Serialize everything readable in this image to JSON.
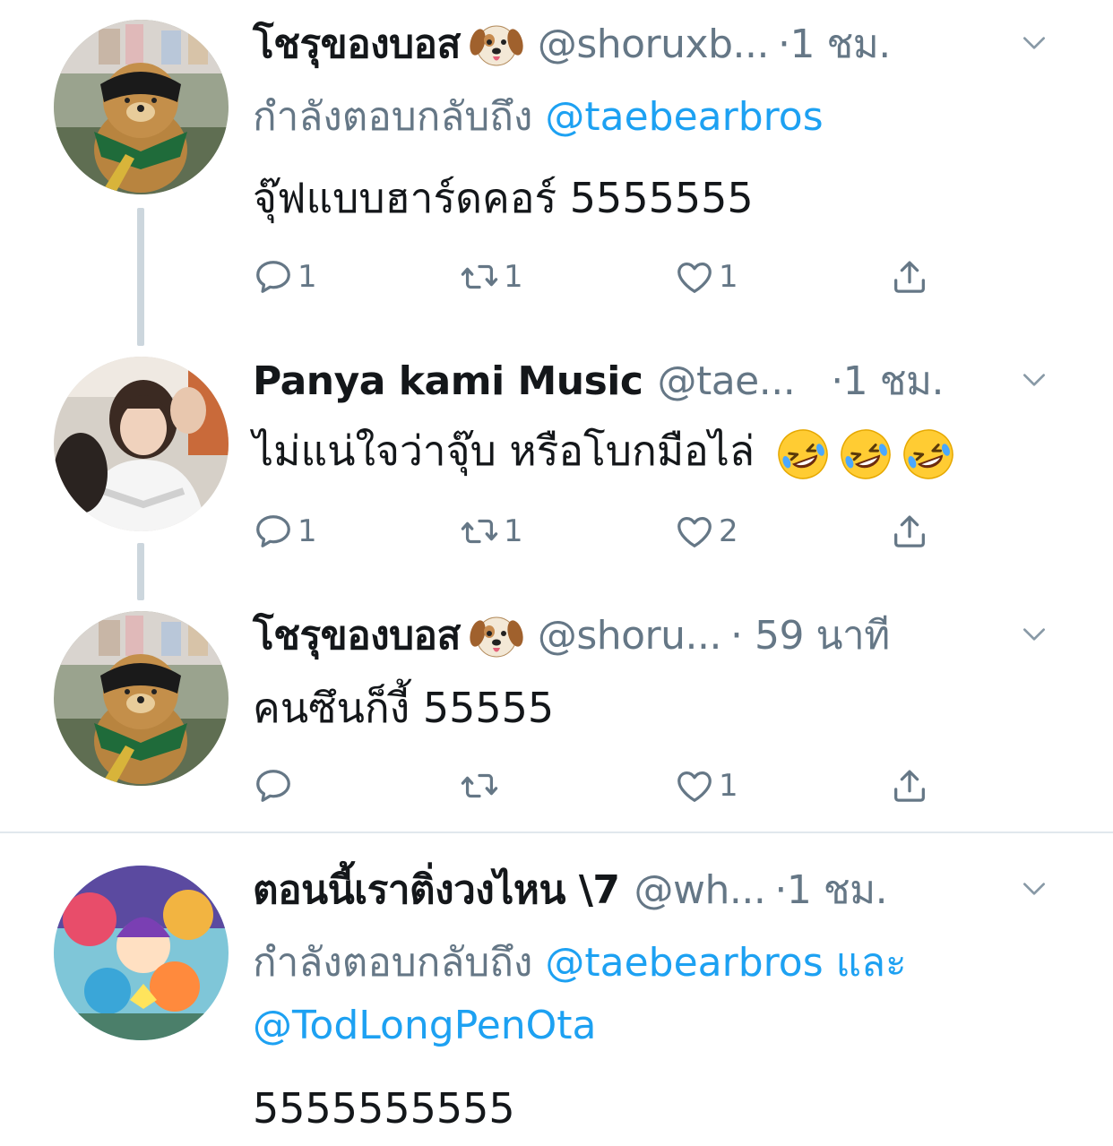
{
  "tweets": [
    {
      "name": "โชรุของบอส",
      "name_emoji": "dog-face-emoji",
      "handle": "@shoruxb...",
      "time": "·1 ชม.",
      "reply_prefix": "กำลังตอบกลับถึง",
      "reply_mention": "@taebearbros",
      "text": "จุ๊ฟแบบฮาร์ดคอร์ 5555555",
      "replies": "1",
      "retweets": "1",
      "likes": "1"
    },
    {
      "name": "Panya kami Music",
      "handle": "@tae...",
      "time": "·1 ชม.",
      "text": "ไม่แน่ใจว่าจุ๊บ หรือโบกมือไล่",
      "text_emojis": [
        "rofl-emoji",
        "rofl-emoji",
        "rofl-emoji"
      ],
      "replies": "1",
      "retweets": "1",
      "likes": "2"
    },
    {
      "name": "โชรุของบอส",
      "name_emoji": "dog-face-emoji",
      "handle": "@shoru...",
      "time": "· 59 นาที",
      "text": "คนซึนก็งี้ 55555",
      "replies": "",
      "retweets": "",
      "likes": "1"
    },
    {
      "name": "ตอนนี้เราติ่งวงไหน \\7",
      "handle": "@wh...",
      "time": "·1 ชม.",
      "reply_prefix": "กำลังตอบกลับถึง",
      "reply_mention": "@taebearbros",
      "reply_and": "และ",
      "reply_mention2": "@TodLongPenOta",
      "text": "5555555555"
    }
  ],
  "colors": {
    "link": "#1da1f2",
    "muted": "#657786",
    "text": "#14171a",
    "thread_line": "#ccd6dd"
  }
}
